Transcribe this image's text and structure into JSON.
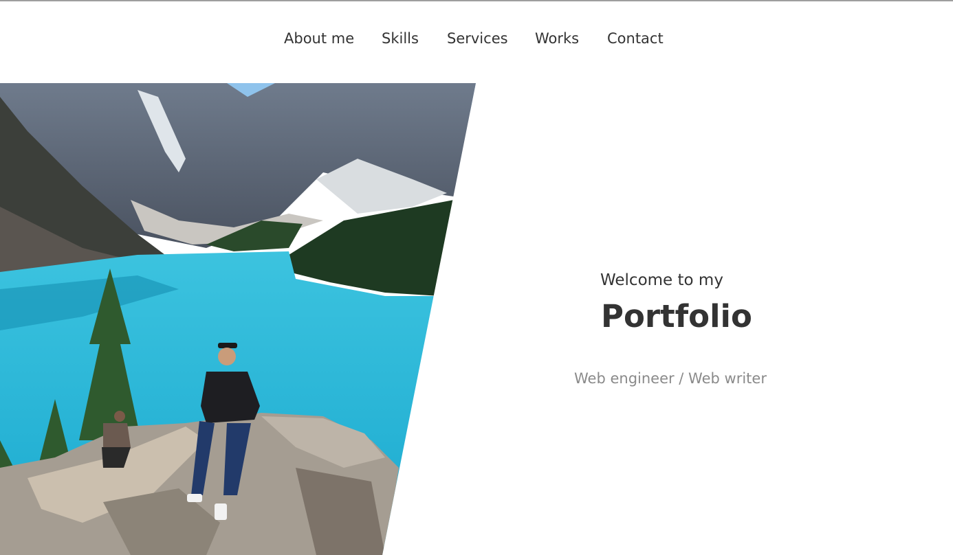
{
  "nav": {
    "items": [
      {
        "label": "About me"
      },
      {
        "label": "Skills"
      },
      {
        "label": "Services"
      },
      {
        "label": "Works"
      },
      {
        "label": "Contact"
      }
    ]
  },
  "hero": {
    "welcome": "Welcome to my",
    "title": "Portfolio",
    "subtitle": "Web engineer / Web writer"
  },
  "colors": {
    "text": "#333333",
    "subtitle": "#8a8a8a",
    "lake": "#23b5d6",
    "sky": "#8fc3ec"
  }
}
